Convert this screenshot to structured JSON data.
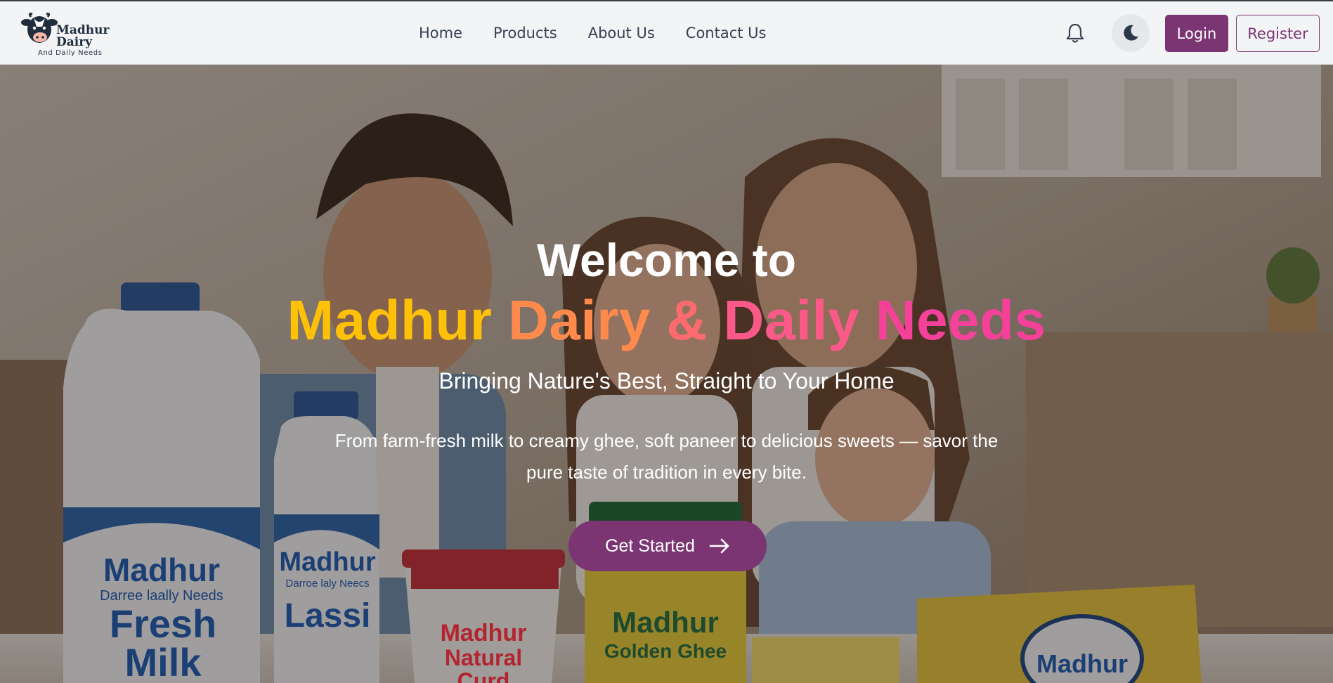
{
  "brand": {
    "logo_line1": "Madhur",
    "logo_line2": "Dairy",
    "logo_line3": "And Daily Needs"
  },
  "nav": {
    "links": [
      {
        "label": "Home"
      },
      {
        "label": "Products"
      },
      {
        "label": "About Us"
      },
      {
        "label": "Contact Us"
      }
    ],
    "icons": [
      "bell-icon",
      "moon-icon"
    ],
    "login_label": "Login",
    "register_label": "Register"
  },
  "hero": {
    "welcome": "Welcome to",
    "brand_parts": [
      "Madhur ",
      "Dairy ",
      "& ",
      "Daily ",
      "Needs"
    ],
    "tagline": "Bringing Nature's Best, Straight to Your Home",
    "description": "From farm-fresh milk to creamy ghee, soft paneer to delicious sweets — savor the pure taste of tradition in every bite.",
    "cta_label": "Get Started",
    "cta_icon": "arrow-right-icon",
    "product_labels": {
      "milk_brand": "Madhur",
      "milk_sub": "Darree laally Needs",
      "milk_name_1": "Fresh",
      "milk_name_2": "Milk",
      "lassi_brand": "Madhur",
      "lassi_sub": "Darroe laly Neecs",
      "lassi_name": "Lassi",
      "curd_brand": "Madhur",
      "curd_name_1": "Natural",
      "curd_name_2": "Curd",
      "ghee_brand": "Madhur",
      "ghee_name": "Golden Ghee",
      "butter_brand": "Madhur"
    }
  },
  "colors": {
    "primary": "#7b3573",
    "nav_bg": "#f3f4f6",
    "gradient": [
      "#ffc107",
      "#ff8a4c",
      "#ff6a6f",
      "#fb5a88",
      "#f5419a"
    ]
  }
}
